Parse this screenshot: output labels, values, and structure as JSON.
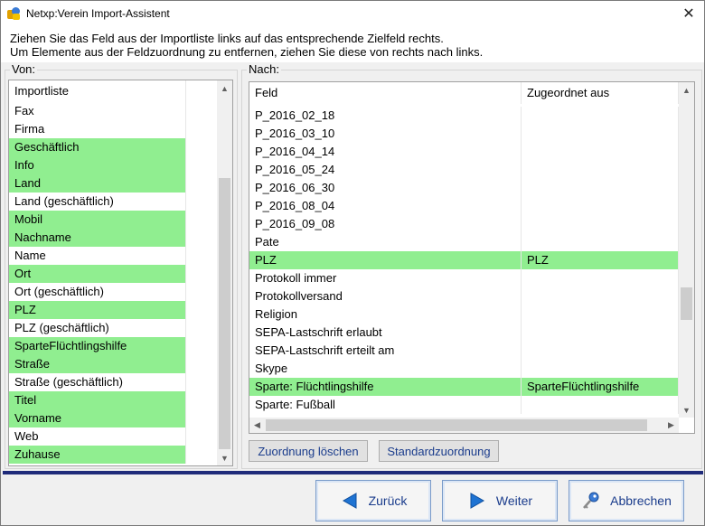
{
  "window": {
    "title": "Netxp:Verein Import-Assistent",
    "close_glyph": "✕"
  },
  "instructions": {
    "line1": "Ziehen Sie das Feld aus der Importliste links auf das entsprechende Zielfeld rechts.",
    "line2": "Um Elemente aus der Feldzuordnung zu entfernen, ziehen Sie diese von rechts nach links."
  },
  "left": {
    "group_label": "Von:",
    "header": "Importliste",
    "items": [
      {
        "label": "Fax",
        "mapped": false
      },
      {
        "label": "Firma",
        "mapped": false
      },
      {
        "label": "Geschäftlich",
        "mapped": true
      },
      {
        "label": "Info",
        "mapped": true
      },
      {
        "label": "Land",
        "mapped": true
      },
      {
        "label": "Land (geschäftlich)",
        "mapped": false
      },
      {
        "label": "Mobil",
        "mapped": true
      },
      {
        "label": "Nachname",
        "mapped": true
      },
      {
        "label": "Name",
        "mapped": false
      },
      {
        "label": "Ort",
        "mapped": true
      },
      {
        "label": "Ort (geschäftlich)",
        "mapped": false
      },
      {
        "label": "PLZ",
        "mapped": true
      },
      {
        "label": "PLZ (geschäftlich)",
        "mapped": false
      },
      {
        "label": "SparteFlüchtlingshilfe",
        "mapped": true
      },
      {
        "label": "Straße",
        "mapped": true
      },
      {
        "label": "Straße (geschäftlich)",
        "mapped": false
      },
      {
        "label": "Titel",
        "mapped": true
      },
      {
        "label": "Vorname",
        "mapped": true
      },
      {
        "label": "Web",
        "mapped": false
      },
      {
        "label": "Zuhause",
        "mapped": true
      }
    ]
  },
  "right": {
    "group_label": "Nach:",
    "headers": {
      "field": "Feld",
      "assigned": "Zugeordnet aus"
    },
    "rows": [
      {
        "field": "P_2016_02_18",
        "assigned": "",
        "mapped": false
      },
      {
        "field": "P_2016_03_10",
        "assigned": "",
        "mapped": false
      },
      {
        "field": "P_2016_04_14",
        "assigned": "",
        "mapped": false
      },
      {
        "field": "P_2016_05_24",
        "assigned": "",
        "mapped": false
      },
      {
        "field": "P_2016_06_30",
        "assigned": "",
        "mapped": false
      },
      {
        "field": "P_2016_08_04",
        "assigned": "",
        "mapped": false
      },
      {
        "field": "P_2016_09_08",
        "assigned": "",
        "mapped": false
      },
      {
        "field": "Pate",
        "assigned": "",
        "mapped": false
      },
      {
        "field": "PLZ",
        "assigned": "PLZ",
        "mapped": true
      },
      {
        "field": "Protokoll immer",
        "assigned": "",
        "mapped": false
      },
      {
        "field": "Protokollversand",
        "assigned": "",
        "mapped": false
      },
      {
        "field": "Religion",
        "assigned": "",
        "mapped": false
      },
      {
        "field": "SEPA-Lastschrift erlaubt",
        "assigned": "",
        "mapped": false
      },
      {
        "field": "SEPA-Lastschrift erteilt am",
        "assigned": "",
        "mapped": false
      },
      {
        "field": "Skype",
        "assigned": "",
        "mapped": false
      },
      {
        "field": "Sparte: Flüchtlingshilfe",
        "assigned": "SparteFlüchtlingshilfe",
        "mapped": true
      },
      {
        "field": "Sparte: Fußball",
        "assigned": "",
        "mapped": false
      }
    ],
    "clear_button": "Zuordnung löschen",
    "default_button": "Standardzuordnung"
  },
  "footer": {
    "back": "Zurück",
    "next": "Weiter",
    "cancel": "Abbrechen"
  },
  "colors": {
    "mapped": "#90ee90",
    "accent": "#1f2b7a",
    "button_text": "#1a3c8c"
  },
  "icons": {
    "back": "arrow-left-icon",
    "next": "arrow-right-icon",
    "cancel": "key-icon"
  }
}
